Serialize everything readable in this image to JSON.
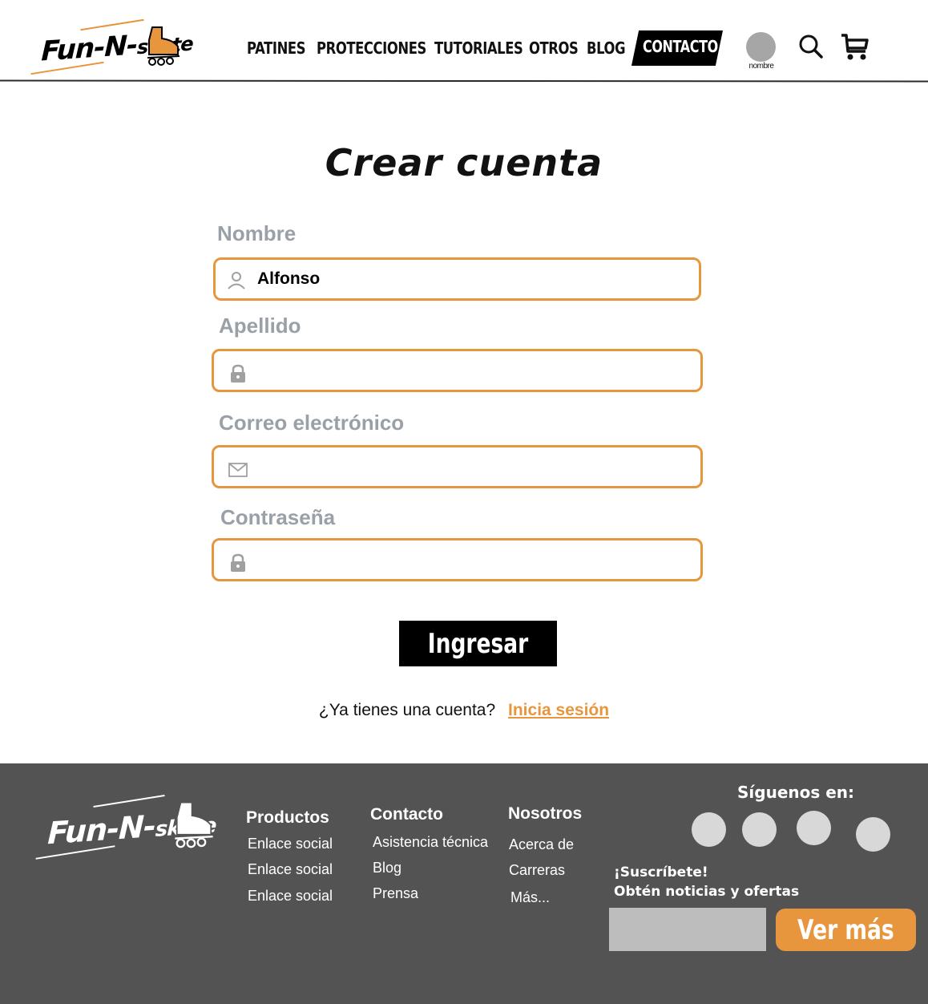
{
  "header": {
    "logo": {
      "part1": "Fun-N-",
      "part2": "skate"
    },
    "nav": [
      "PATINES",
      "PROTECCIONES",
      "TUTORIALES",
      "OTROS",
      "BLOG"
    ],
    "nav_contact": "CONTACTO",
    "user_name": "nombre",
    "icons": [
      "search-icon",
      "cart-icon"
    ]
  },
  "form": {
    "title": "Crear cuenta",
    "fields": [
      {
        "label": "Nombre",
        "value": "Alfonso",
        "icon": "user-icon"
      },
      {
        "label": "Apellido",
        "value": "",
        "icon": "lock-icon"
      },
      {
        "label": "Correo electrónico",
        "value": "",
        "icon": "mail-icon"
      },
      {
        "label": "Contraseña",
        "value": "",
        "icon": "lock-icon"
      }
    ],
    "submit_label": "Ingresar",
    "login_prompt": "¿Ya tienes una cuenta?",
    "login_link": "Inicia sesión"
  },
  "footer": {
    "logo": {
      "part1": "Fun-N-",
      "part2": "skate"
    },
    "columns": [
      {
        "title": "Productos",
        "links": [
          "Enlace social",
          "Enlace social",
          "Enlace social"
        ]
      },
      {
        "title": "Contacto",
        "links": [
          "Asistencia técnica",
          "Blog",
          "Prensa"
        ]
      },
      {
        "title": "Nosotros",
        "links": [
          "Acerca de",
          "Carreras",
          "Más..."
        ]
      }
    ],
    "follow_label": "Síguenos en:",
    "subscribe_line1": "¡Suscríbete!",
    "subscribe_line2": "Obtén noticias y ofertas",
    "subscribe_button": "Ver más"
  },
  "colors": {
    "accent": "#e8963d",
    "footer_bg": "#535353",
    "label_gray": "#9aa0a8"
  }
}
